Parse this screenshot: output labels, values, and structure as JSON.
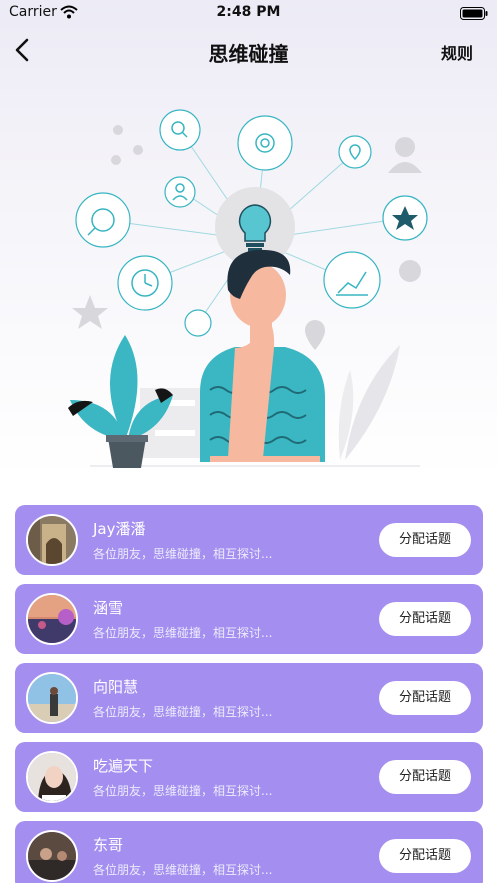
{
  "status_bar": {
    "carrier": "Carrier",
    "time": "2:48 PM"
  },
  "nav": {
    "title": "思维碰撞",
    "rules_label": "规则"
  },
  "illustration": {
    "name": "thinking-person-illustration"
  },
  "list": {
    "items": [
      {
        "name": "Jay潘潘",
        "desc": "各位朋友，思维碰撞，相互探讨...",
        "button": "分配话题"
      },
      {
        "name": "涵雪",
        "desc": "各位朋友，思维碰撞，相互探讨...",
        "button": "分配话题"
      },
      {
        "name": "向阳慧",
        "desc": "各位朋友，思维碰撞，相互探讨...",
        "button": "分配话题"
      },
      {
        "name": "吃遍天下",
        "desc": "各位朋友，思维碰撞，相互探讨...",
        "button": "分配话题"
      },
      {
        "name": "东哥",
        "desc": "各位朋友，思维碰撞，相互探讨...",
        "button": "分配话题"
      }
    ]
  },
  "colors": {
    "card": "#a48ff0",
    "accent_teal": "#38b5c2",
    "button_bg": "#ffffff"
  }
}
